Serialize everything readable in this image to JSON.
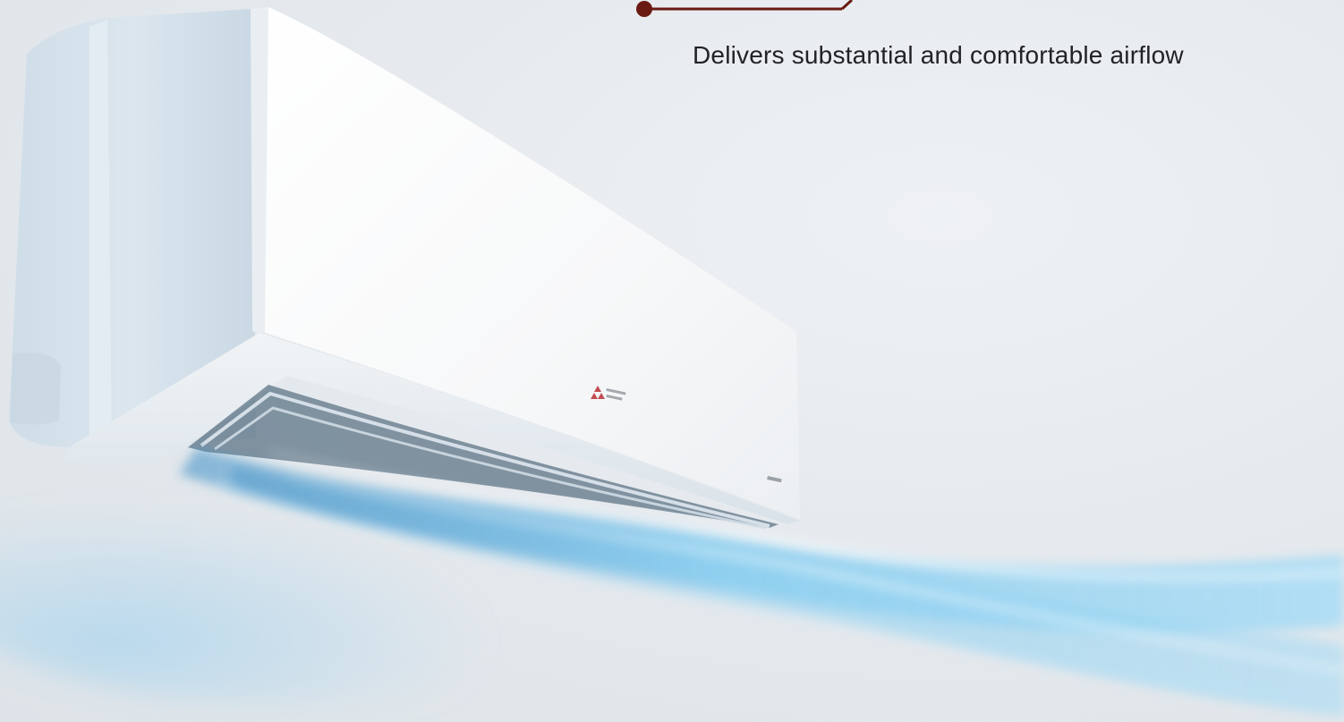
{
  "tagline": "Delivers substantial and comfortable airflow",
  "brand_logo": "Mitsubishi Electric logo on the front panel",
  "colors": {
    "callout_line": "#6a1a12",
    "callout_dot": "#6a1a12",
    "tagline_text": "#222226",
    "airflow": "#7fc6ea"
  }
}
